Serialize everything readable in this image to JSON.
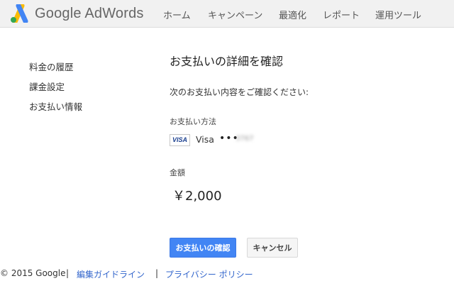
{
  "header": {
    "brand": "Google AdWords",
    "nav": [
      "ホーム",
      "キャンペーン",
      "最適化",
      "レポート",
      "運用ツール"
    ]
  },
  "sidebar": {
    "items": [
      "料金の履歴",
      "課金設定",
      "お支払い情報"
    ]
  },
  "main": {
    "title": "お支払いの詳細を確認",
    "instruction": "次のお支払い内容をご確認ください:",
    "payment_method_label": "お支払い方法",
    "card_brand_badge": "VISA",
    "card_name": "Visa",
    "card_dots": "•••",
    "card_digits": "3767",
    "amount_label": "金額",
    "amount": "￥2,000",
    "confirm_button": "お支払いの確認",
    "cancel_button": "キャンセル"
  },
  "footer": {
    "copyright": "© 2015 Google",
    "separator": "|",
    "links": [
      "編集ガイドライン",
      "プライバシー ポリシー"
    ]
  },
  "colors": {
    "primary_button": "#4285f4",
    "link": "#3366cc",
    "header_bg": "#f1f1f1",
    "logo_blue": "#4285f4",
    "logo_yellow": "#fbbc05",
    "logo_green": "#34a853"
  }
}
